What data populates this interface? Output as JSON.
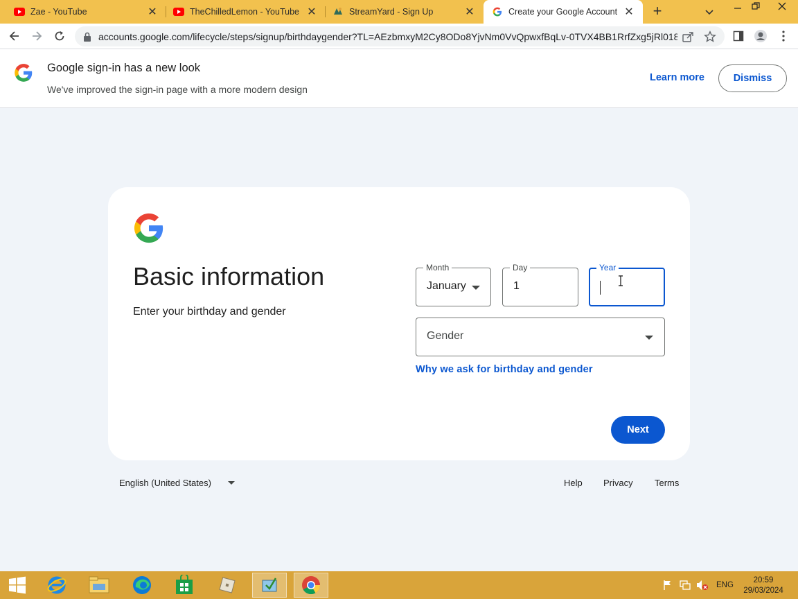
{
  "browser": {
    "tabs": [
      {
        "title": "Zae - YouTube",
        "icon": "youtube-icon",
        "active": false
      },
      {
        "title": "TheChilledLemon - YouTube",
        "icon": "youtube-icon",
        "active": false
      },
      {
        "title": "StreamYard - Sign Up",
        "icon": "streamyard-icon",
        "active": false
      },
      {
        "title": "Create your Google Account",
        "icon": "google-icon",
        "active": true
      }
    ],
    "url": "accounts.google.com/lifecycle/steps/signup/birthdaygender?TL=AEzbmxyM2Cy8ODo8YjvNm0VvQpwxfBqLv-0TVX4BB1RrfZxg5jRl018..."
  },
  "banner": {
    "title": "Google sign-in has a new look",
    "subtitle": "We've improved the sign-in page with a more modern design",
    "learn_more": "Learn more",
    "dismiss": "Dismiss"
  },
  "form": {
    "heading": "Basic information",
    "subheading": "Enter your birthday and gender",
    "month": {
      "label": "Month",
      "value": "January"
    },
    "day": {
      "label": "Day",
      "value": "1"
    },
    "year": {
      "label": "Year",
      "value": ""
    },
    "gender": {
      "placeholder": "Gender"
    },
    "why_link": "Why we ask for birthday and gender",
    "next": "Next"
  },
  "footer": {
    "language": "English (United States)",
    "help": "Help",
    "privacy": "Privacy",
    "terms": "Terms"
  },
  "taskbar": {
    "language": "ENG",
    "time": "20:59",
    "date": "29/03/2024"
  },
  "colors": {
    "accent": "#0b57d0",
    "tabstrip": "#f2c14e",
    "taskbar": "#d9a43a",
    "page_background": "#f0f4f9"
  }
}
